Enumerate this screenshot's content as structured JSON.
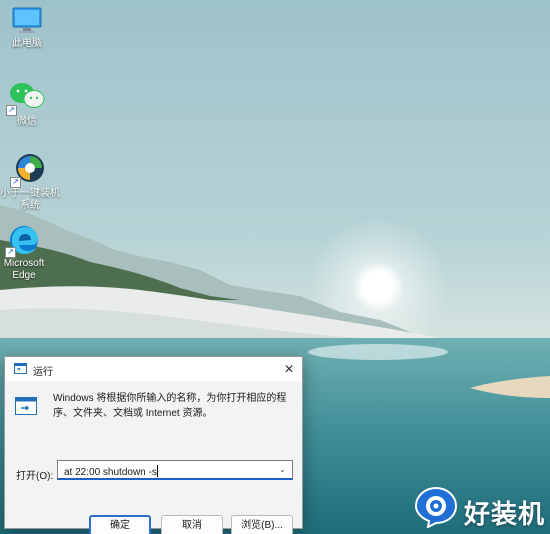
{
  "desktop": {
    "icons": [
      {
        "label": "此电脑",
        "icon": "this-pc-icon"
      },
      {
        "label": "微信",
        "icon": "wechat-icon"
      },
      {
        "label_line1": "小于一键装机",
        "label_line2": "系统",
        "icon": "installer-app-icon"
      },
      {
        "label_line1": "Microsoft",
        "label_line2": "Edge",
        "icon": "edge-icon"
      }
    ]
  },
  "run_dialog": {
    "title": "运行",
    "description": "Windows 将根据你所输入的名称，为你打开相应的程序、文件夹、文档或 Internet 资源。",
    "open_label": "打开(O):",
    "input_value": "at 22:00 shutdown -s",
    "buttons": {
      "ok": "确定",
      "cancel": "取消",
      "browse": "浏览(B)..."
    },
    "accent": "#1a60c8"
  },
  "watermark": {
    "text": "好装机",
    "logo": "bubble-logo-icon",
    "color": "#1f6fd6"
  }
}
